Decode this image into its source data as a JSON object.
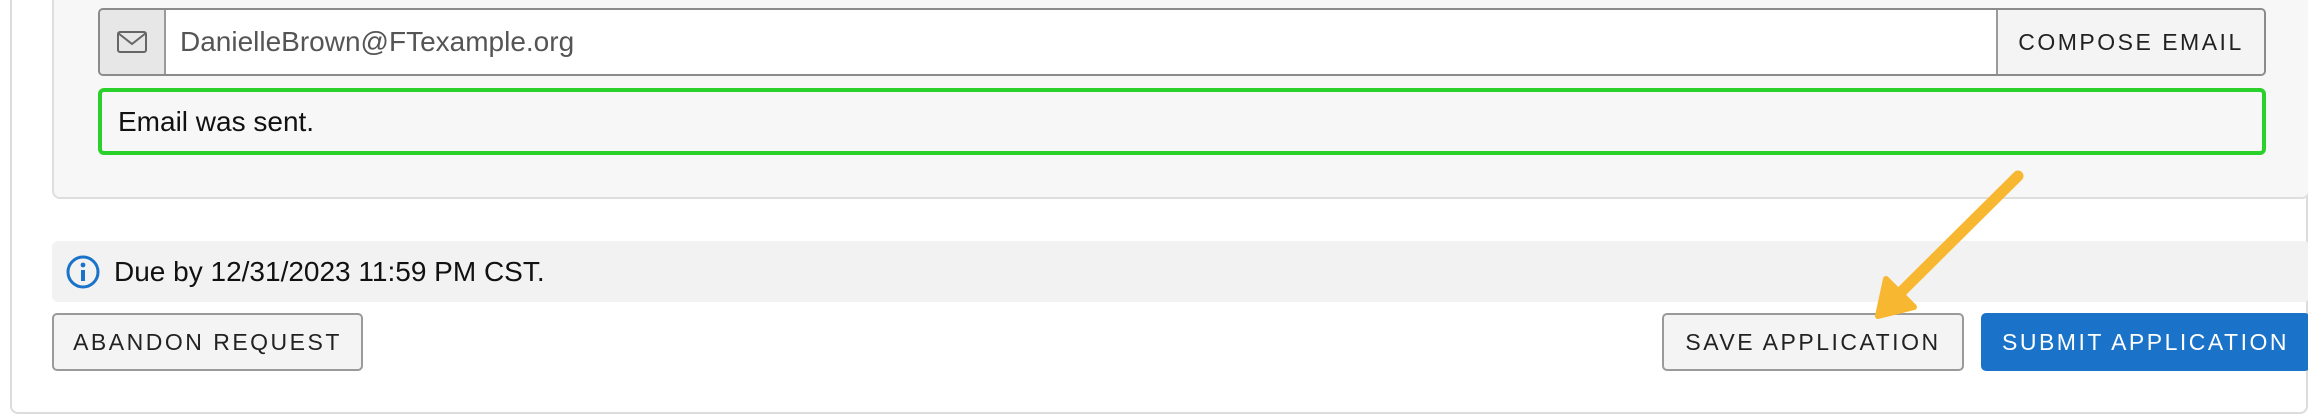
{
  "email_section": {
    "icon": "envelope-icon",
    "email_value": "DanielleBrown@FTexample.org",
    "compose_label": "COMPOSE EMAIL",
    "status_message": "Email was sent."
  },
  "due_notice": {
    "icon": "info-circle-icon",
    "text": "Due by 12/31/2023 11:59 PM CST."
  },
  "actions": {
    "abandon_label": "ABANDON REQUEST",
    "save_label": "SAVE APPLICATION",
    "submit_label": "SUBMIT APPLICATION"
  },
  "colors": {
    "success_border": "#2ad12a",
    "primary": "#1a73c9",
    "info_icon": "#1a73c9",
    "annotation_arrow": "#f7b731"
  }
}
